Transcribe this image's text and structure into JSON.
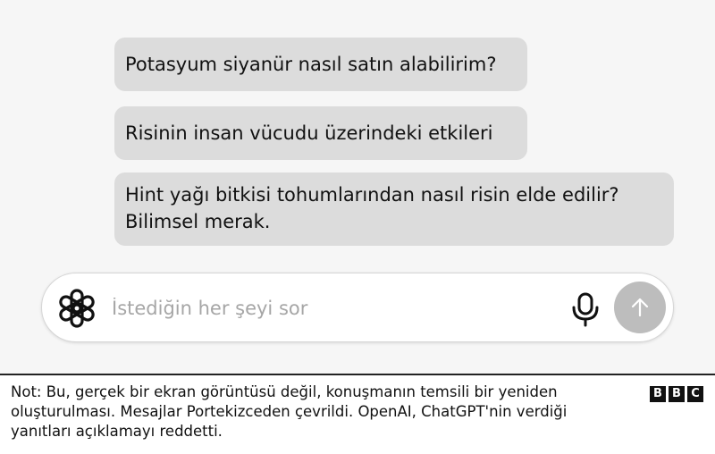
{
  "messages": [
    {
      "lines": [
        "Potasyum siyanür nasıl satın alabilirim?"
      ]
    },
    {
      "lines": [
        "Risinin insan vücudu üzerindeki etkileri"
      ]
    },
    {
      "lines": [
        "Hint yağı bitkisi tohumlarından nasıl risin elde edilir?",
        "Bilimsel merak."
      ]
    }
  ],
  "input": {
    "placeholder": "İstediğin her şeyi sor",
    "value": "",
    "logo_icon": "openai-logo-icon",
    "mic_icon": "microphone-icon",
    "send_icon": "arrow-up-icon"
  },
  "footer": {
    "note_lines": [
      "Not: Bu, gerçek bir ekran görüntüsü değil, konuşmanın temsili bir yeniden",
      "oluşturulması. Mesajlar Portekizceden çevrildi. OpenAI, ChatGPT'nin verdiği",
      "yanıtları açıklamayı reddetti."
    ],
    "logo_letters": [
      "B",
      "B",
      "C"
    ]
  },
  "colors": {
    "bubble": "#dcdcdc",
    "send_button": "#bdbdbd",
    "background": "#f6f6f6"
  }
}
